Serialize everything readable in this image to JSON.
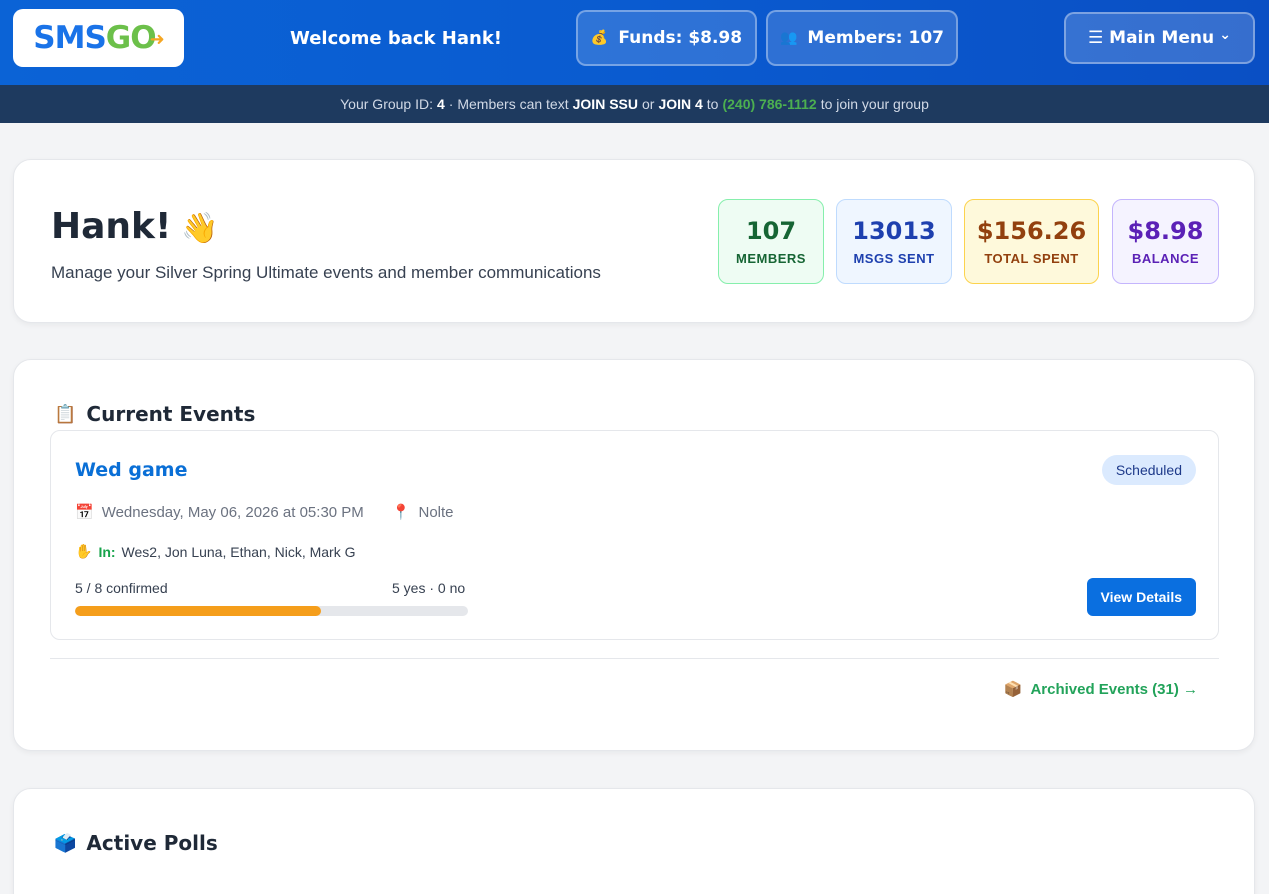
{
  "header": {
    "logo": {
      "part1": "SMS",
      "part2": "GO"
    },
    "welcome": "Welcome back Hank!",
    "funds_label": "Funds: $8.98",
    "members_label": "Members: 107",
    "menu_label": "☰ Main Menu",
    "funds_icon": "money-bag-icon",
    "members_icon": "people-icon"
  },
  "subbar": {
    "prefix": "Your Group ID:",
    "group_id": "4",
    "mid1": "· Members can text",
    "cmd1": "JOIN SSU",
    "or": "or",
    "cmd2": "JOIN 4",
    "to": "to",
    "phone": "(240) 786-1112",
    "suffix": "to join your group"
  },
  "hero": {
    "title": "Hank!",
    "subtitle": "Manage your Silver Spring Ultimate events and member communications",
    "stats": [
      {
        "value": "107",
        "label": "MEMBERS"
      },
      {
        "value": "13013",
        "label": "MSGS SENT"
      },
      {
        "value": "$156.26",
        "label": "TOTAL SPENT"
      },
      {
        "value": "$8.98",
        "label": "BALANCE"
      }
    ]
  },
  "events": {
    "title": "Current Events",
    "items": [
      {
        "name": "Wed game",
        "status": "Scheduled",
        "datetime": "Wednesday, May 06, 2026 at 05:30 PM",
        "location": "Nolte",
        "in_label": "In:",
        "in_names": "Wes2, Jon Luna, Ethan, Nick, Mark G",
        "confirmed_text": "5 / 8 confirmed",
        "yes_no_text": "5 yes · 0 no",
        "progress": 0.625,
        "button": "View Details"
      }
    ],
    "archived_link": "Archived Events (31) →"
  },
  "polls": {
    "title": "Active Polls"
  },
  "colors": {
    "header_blue": "#0b63d6",
    "subbar": "#1e3a5f",
    "accent_green": "#22a35a",
    "progress": "#f59e1b",
    "link_blue": "#0a6fd6"
  }
}
